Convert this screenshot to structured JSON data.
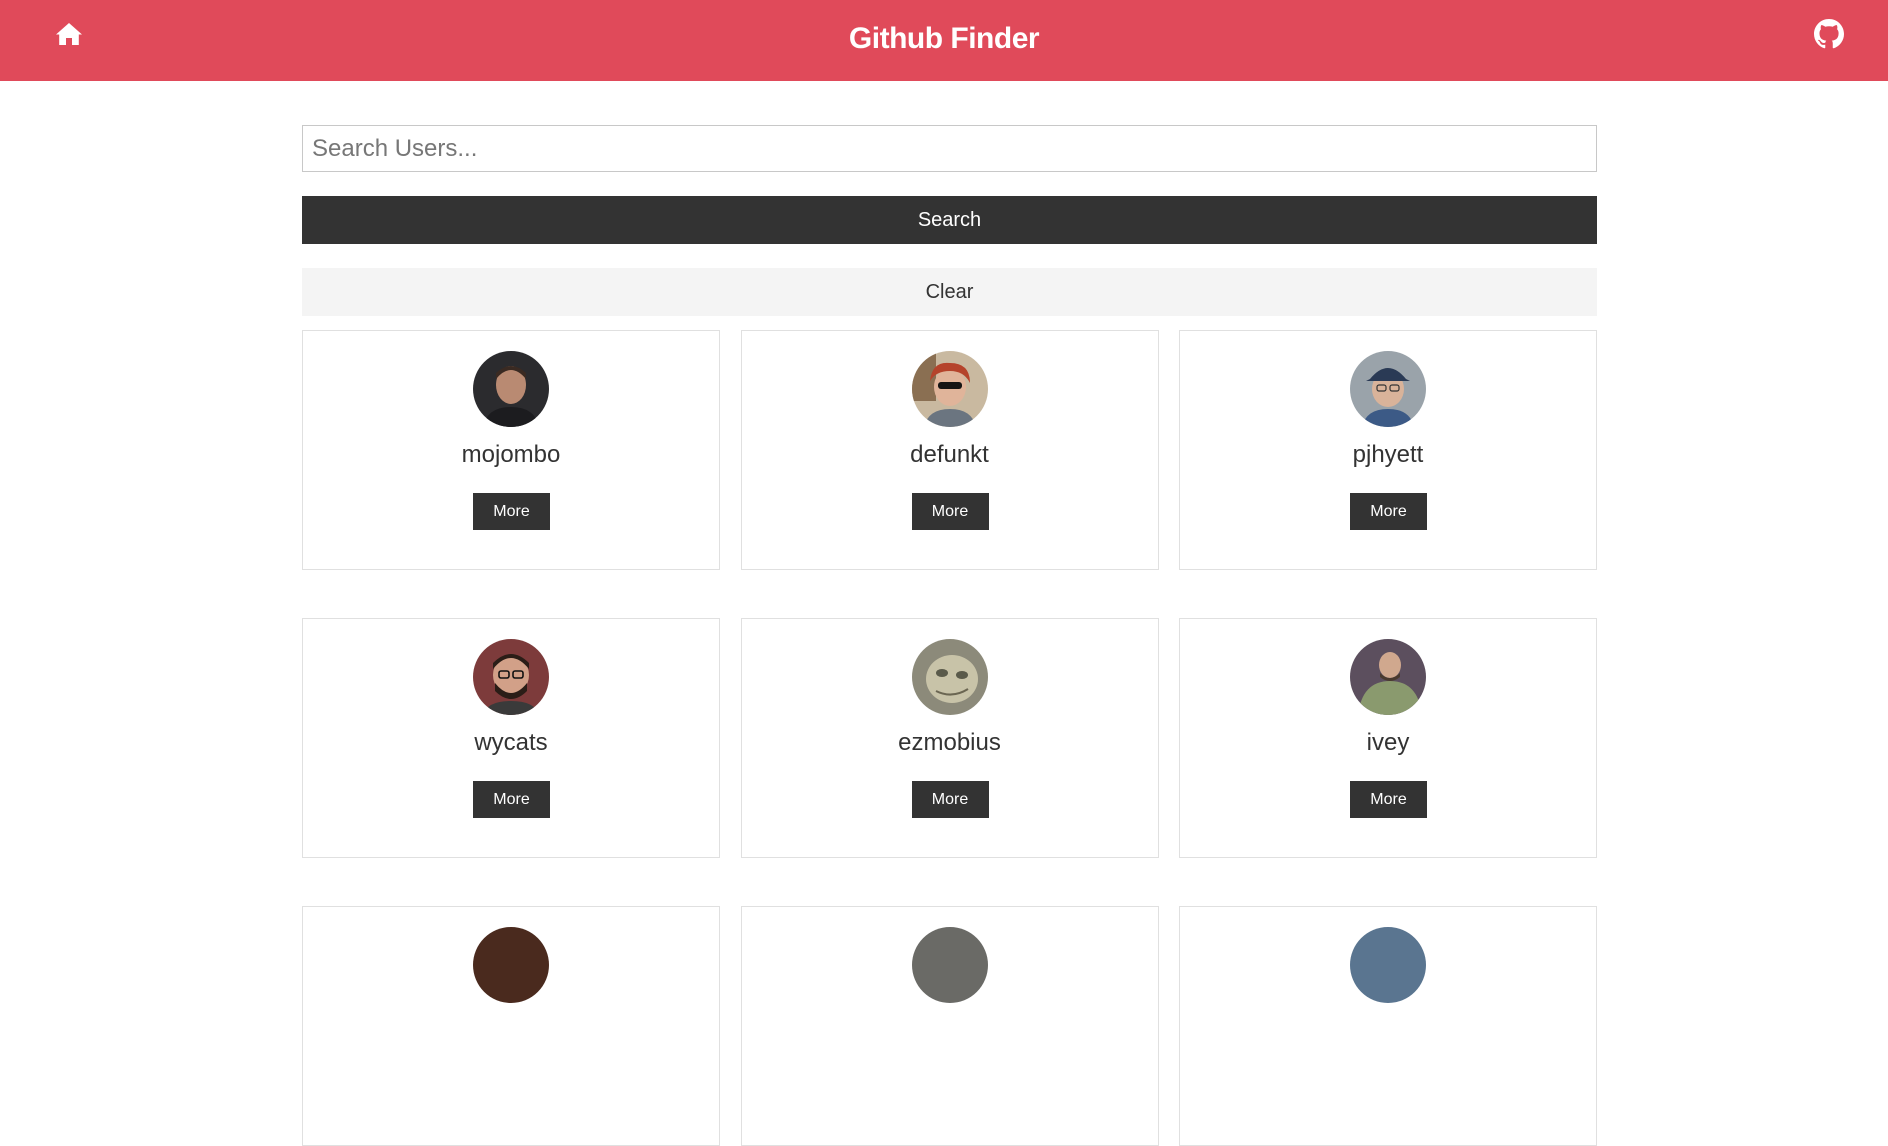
{
  "navbar": {
    "title": "Github Finder",
    "home_icon": "home-icon",
    "github_icon": "github-icon",
    "color": "#e04a5a"
  },
  "search": {
    "placeholder": "Search Users...",
    "value": "",
    "search_label": "Search",
    "clear_label": "Clear"
  },
  "users": [
    {
      "login": "mojombo",
      "more_label": "More"
    },
    {
      "login": "defunkt",
      "more_label": "More"
    },
    {
      "login": "pjhyett",
      "more_label": "More"
    },
    {
      "login": "wycats",
      "more_label": "More"
    },
    {
      "login": "ezmobius",
      "more_label": "More"
    },
    {
      "login": "ivey",
      "more_label": "More"
    }
  ]
}
